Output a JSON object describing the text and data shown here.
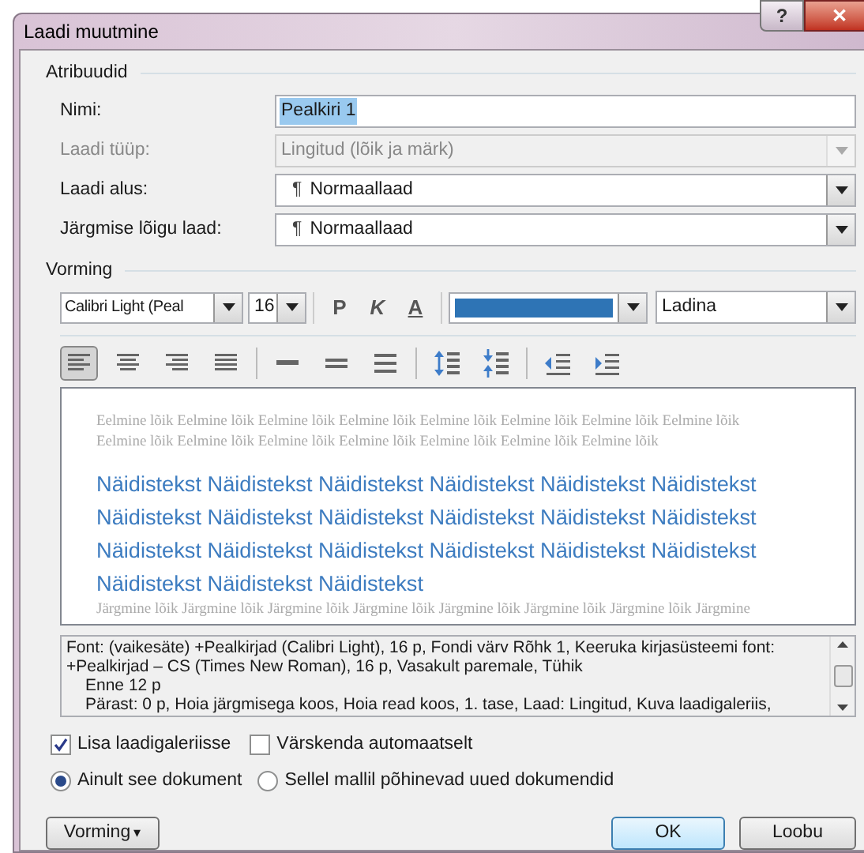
{
  "window": {
    "title": "Laadi muutmine",
    "help": "?",
    "close": "✕"
  },
  "properties": {
    "title": "Atribuudid",
    "rows": [
      {
        "label": "Nimi:",
        "kind": "text",
        "value": "Pealkiri 1",
        "disabled": false
      },
      {
        "label": "Laadi tüüp:",
        "kind": "select",
        "value": "Lingitud (lõik ja märk)",
        "disabled": true
      },
      {
        "label": "Laadi alus:",
        "kind": "select",
        "value": "Normaallaad",
        "mark": "¶",
        "disabled": false
      },
      {
        "label": "Järgmise lõigu laad:",
        "kind": "select",
        "value": "Normaallaad",
        "mark": "¶",
        "disabled": false
      }
    ]
  },
  "formatting": {
    "title": "Vorming",
    "font": "Calibri Light (Peal",
    "size": "16",
    "bold": "P",
    "italic": "K",
    "underline": "A",
    "color": "#2e74b5",
    "language": "Ladina",
    "tool_groups": [
      [
        {
          "kind": "align-left",
          "selected": true
        },
        {
          "kind": "align-center",
          "selected": false
        },
        {
          "kind": "align-right",
          "selected": false
        },
        {
          "kind": "justify",
          "selected": false
        }
      ],
      [
        {
          "kind": "single",
          "selected": false
        },
        {
          "kind": "one-half",
          "selected": false
        },
        {
          "kind": "double",
          "selected": false
        }
      ],
      [
        {
          "kind": "space-more",
          "selected": false
        },
        {
          "kind": "space-less",
          "selected": false
        }
      ],
      [
        {
          "kind": "outdent",
          "selected": false
        },
        {
          "kind": "indent",
          "selected": false
        }
      ]
    ]
  },
  "preview": {
    "previous": [
      "Eelmine lõik Eelmine lõik Eelmine lõik Eelmine lõik Eelmine lõik Eelmine lõik Eelmine lõik Eelmine lõik",
      "Eelmine lõik Eelmine lõik Eelmine lõik Eelmine lõik Eelmine lõik Eelmine lõik Eelmine lõik"
    ],
    "sample": [
      "Näidistekst Näidistekst Näidistekst Näidistekst Näidistekst Näidistekst",
      "Näidistekst Näidistekst Näidistekst Näidistekst Näidistekst Näidistekst",
      "Näidistekst Näidistekst Näidistekst Näidistekst Näidistekst Näidistekst",
      "Näidistekst Näidistekst Näidistekst"
    ],
    "next": [
      "Järgmine lõik Järgmine lõik Järgmine lõik Järgmine lõik Järgmine lõik Järgmine lõik Järgmine lõik Järgmine"
    ]
  },
  "description": [
    {
      "kind": "main",
      "text": "Font: (vaikesäte) +Pealkirjad (Calibri Light), 16 p, Fondi värv Rõhk 1, Keeruka kirjasüsteemi font:"
    },
    {
      "kind": "main",
      "text": "+Pealkirjad – CS (Times New Roman), 16 p, Vasakult paremale, Tühik"
    },
    {
      "kind": "indented",
      "text": "Enne  12 p"
    },
    {
      "kind": "indented",
      "text": "Pärast:  0 p, Hoia järgmisega koos, Hoia read koos, 1. tase, Laad: Lingitud, Kuva laadigaleriis,"
    }
  ],
  "checkboxes": [
    {
      "label": "Lisa laadigaleriisse",
      "checked": true
    },
    {
      "label": "Värskenda automaatselt",
      "checked": false
    }
  ],
  "radios": [
    {
      "label": "Ainult see dokument",
      "selected": true
    },
    {
      "label": "Sellel mallil põhinevad uued dokumendid",
      "selected": false
    }
  ],
  "buttons": {
    "format": "Vorming",
    "caret": "▾",
    "ok": "OK",
    "cancel": "Loobu"
  }
}
